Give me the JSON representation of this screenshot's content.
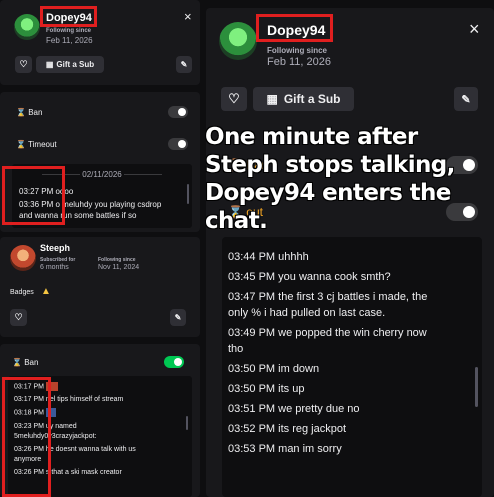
{
  "left_top": {
    "username": "Dopey94",
    "following_label": "Following since",
    "following_date": "Feb 11, 2026",
    "close": "×",
    "gift_label": "Gift a Sub"
  },
  "left_mod": {
    "ban_label": "Ban",
    "timeout_label": "Timeout",
    "date_divider": "02/11/2026",
    "messages": [
      {
        "time": "03:27 PM",
        "text": "oooo"
      },
      {
        "time": "03:36 PM",
        "text": "o meluhdy you playing csdrop"
      },
      {
        "time": "",
        "text": "and wanna run some battles if so"
      }
    ]
  },
  "steeph_card": {
    "username": "Steeph",
    "subscribed_label": "Subscribed for",
    "subscribed_value": "6 months",
    "following_label": "Following since",
    "following_value": "Nov 11, 2024",
    "badges_label": "Badges"
  },
  "left_bottom": {
    "ban_label": "Ban",
    "messages": [
      {
        "time": "03:17 PM",
        "text": ""
      },
      {
        "time": "03:17 PM",
        "text": "nel tips himself of stream"
      },
      {
        "time": "03:18 PM",
        "text": ""
      },
      {
        "time": "03:23 PM",
        "text": "uy named"
      },
      {
        "time": "",
        "text": "5meluhdy0v3crazyjackpot:"
      },
      {
        "time": "03:26 PM",
        "text": "he doesnt wanna talk with us"
      },
      {
        "time": "",
        "text": "anymore"
      },
      {
        "time": "03:26 PM",
        "text": "s that a ski mask creator"
      }
    ]
  },
  "right": {
    "username": "Dopey94",
    "following_label": "Following since",
    "following_date": "Feb 11, 2026",
    "close": "×",
    "gift_label": "Gift a Sub",
    "ban_label": "Ban",
    "timeout_label": "out",
    "overlay_caption": "One minute after Steph stops talking, Dopey94 enters the chat.",
    "messages": [
      {
        "time": "03:44 PM",
        "text": "uhhhh"
      },
      {
        "time": "03:45 PM",
        "text": "you wanna cook smth?"
      },
      {
        "time": "03:47 PM",
        "text": "the first 3 cj battles i made, the"
      },
      {
        "time": "",
        "text": "only % i had pulled on last case."
      },
      {
        "time": "03:49 PM",
        "text": "we popped the win cherry now"
      },
      {
        "time": "",
        "text": "tho"
      },
      {
        "time": "03:50 PM",
        "text": "im down"
      },
      {
        "time": "03:50 PM",
        "text": "its up"
      },
      {
        "time": "03:51 PM",
        "text": "we pretty due no"
      },
      {
        "time": "03:52 PM",
        "text": "its reg jackpot"
      },
      {
        "time": "03:53 PM",
        "text": "man im sorry"
      }
    ]
  },
  "colors": {
    "accent_red": "#e01f1f",
    "toggle_on": "#00c853",
    "ban_icon": "#f5a623",
    "bg": "#0e0e10",
    "panel": "#18181b"
  }
}
